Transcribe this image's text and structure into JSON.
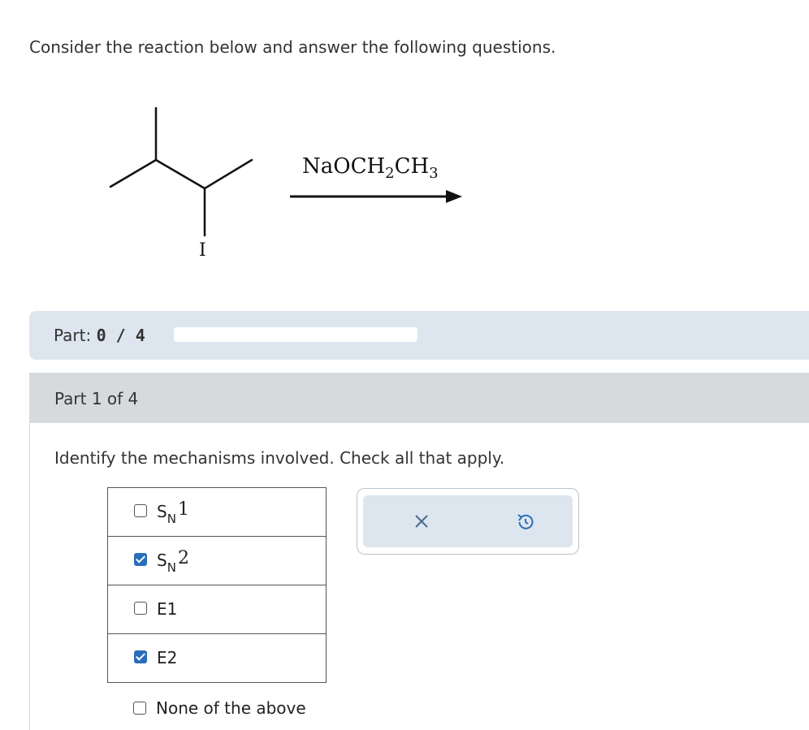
{
  "prompt": "Consider the reaction below and answer the following questions.",
  "reaction": {
    "leaving_group": "I",
    "reagent": {
      "na": "NaOCH",
      "sub1": "2",
      "ch": "CH",
      "sub2": "3"
    }
  },
  "part_progress": {
    "label": "Part:",
    "value": "0 / 4",
    "fraction": 0
  },
  "part_header": "Part 1 of 4",
  "question": "Identify the mechanisms involved. Check all that apply.",
  "choices": [
    {
      "s": "S",
      "sub": "N",
      "num": "1",
      "checked": false
    },
    {
      "s": "S",
      "sub": "N",
      "num": "2",
      "checked": true
    },
    {
      "label": "E1",
      "checked": false
    },
    {
      "label": "E2",
      "checked": true
    }
  ],
  "none_choice": {
    "label": "None of the above",
    "checked": false
  },
  "tools": {
    "clear_icon": "close-icon",
    "undo_icon": "undo-icon"
  },
  "colors": {
    "accent": "#2a6ebb",
    "panel_bg": "#dde6ef",
    "header_bg": "#d6dadd"
  }
}
